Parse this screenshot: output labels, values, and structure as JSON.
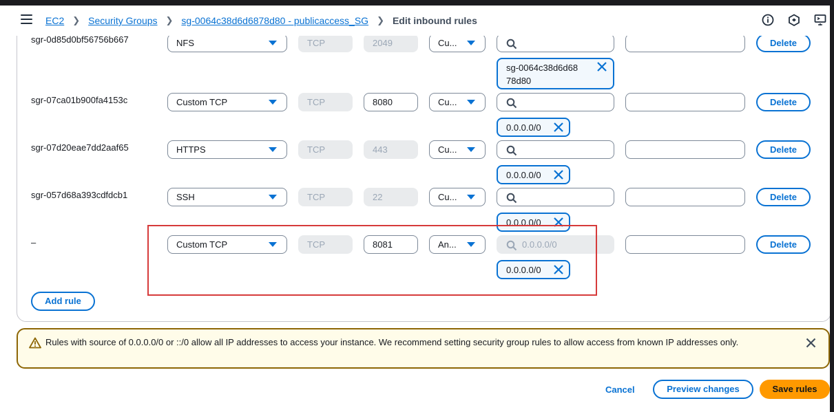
{
  "breadcrumb": {
    "items": [
      "EC2",
      "Security Groups",
      "sg-0064c38d6d6878d80 - publicaccess_SG"
    ],
    "current": "Edit inbound rules"
  },
  "rules": [
    {
      "id": "sgr-0d85d0bf56756b667",
      "type": "NFS",
      "protocol": "TCP",
      "port": "2049",
      "source_type": "Cu...",
      "search_placeholder": "",
      "token": [
        "sg-0064c38d6d68",
        "78d80"
      ],
      "description": "",
      "delete_label": "Delete"
    },
    {
      "id": "sgr-07ca01b900fa4153c",
      "type": "Custom TCP",
      "protocol": "TCP",
      "port": "8080",
      "source_type": "Cu...",
      "search_placeholder": "",
      "token": [
        "0.0.0.0/0"
      ],
      "description": "",
      "delete_label": "Delete"
    },
    {
      "id": "sgr-07d20eae7dd2aaf65",
      "type": "HTTPS",
      "protocol": "TCP",
      "port": "443",
      "source_type": "Cu...",
      "search_placeholder": "",
      "token": [
        "0.0.0.0/0"
      ],
      "description": "",
      "delete_label": "Delete"
    },
    {
      "id": "sgr-057d68a393cdfdcb1",
      "type": "SSH",
      "protocol": "TCP",
      "port": "22",
      "source_type": "Cu...",
      "search_placeholder": "",
      "token": [
        "0.0.0.0/0"
      ],
      "description": "",
      "delete_label": "Delete"
    },
    {
      "id": "–",
      "type": "Custom TCP",
      "protocol": "TCP",
      "port": "8081",
      "source_type": "An...",
      "search_placeholder": "0.0.0.0/0",
      "token": [
        "0.0.0.0/0"
      ],
      "description": "",
      "delete_label": "Delete"
    }
  ],
  "add_rule_label": "Add rule",
  "alert": {
    "text": "Rules with source of 0.0.0.0/0 or ::/0 allow all IP addresses to access your instance. We recommend setting security group rules to allow access from known IP addresses only."
  },
  "footer": {
    "cancel_label": "Cancel",
    "preview_label": "Preview changes",
    "save_label": "Save rules"
  },
  "colors": {
    "accent": "#0972d3",
    "primary_button": "#ff9900",
    "warning_border": "#8d6605",
    "highlight": "#d63a3a"
  }
}
